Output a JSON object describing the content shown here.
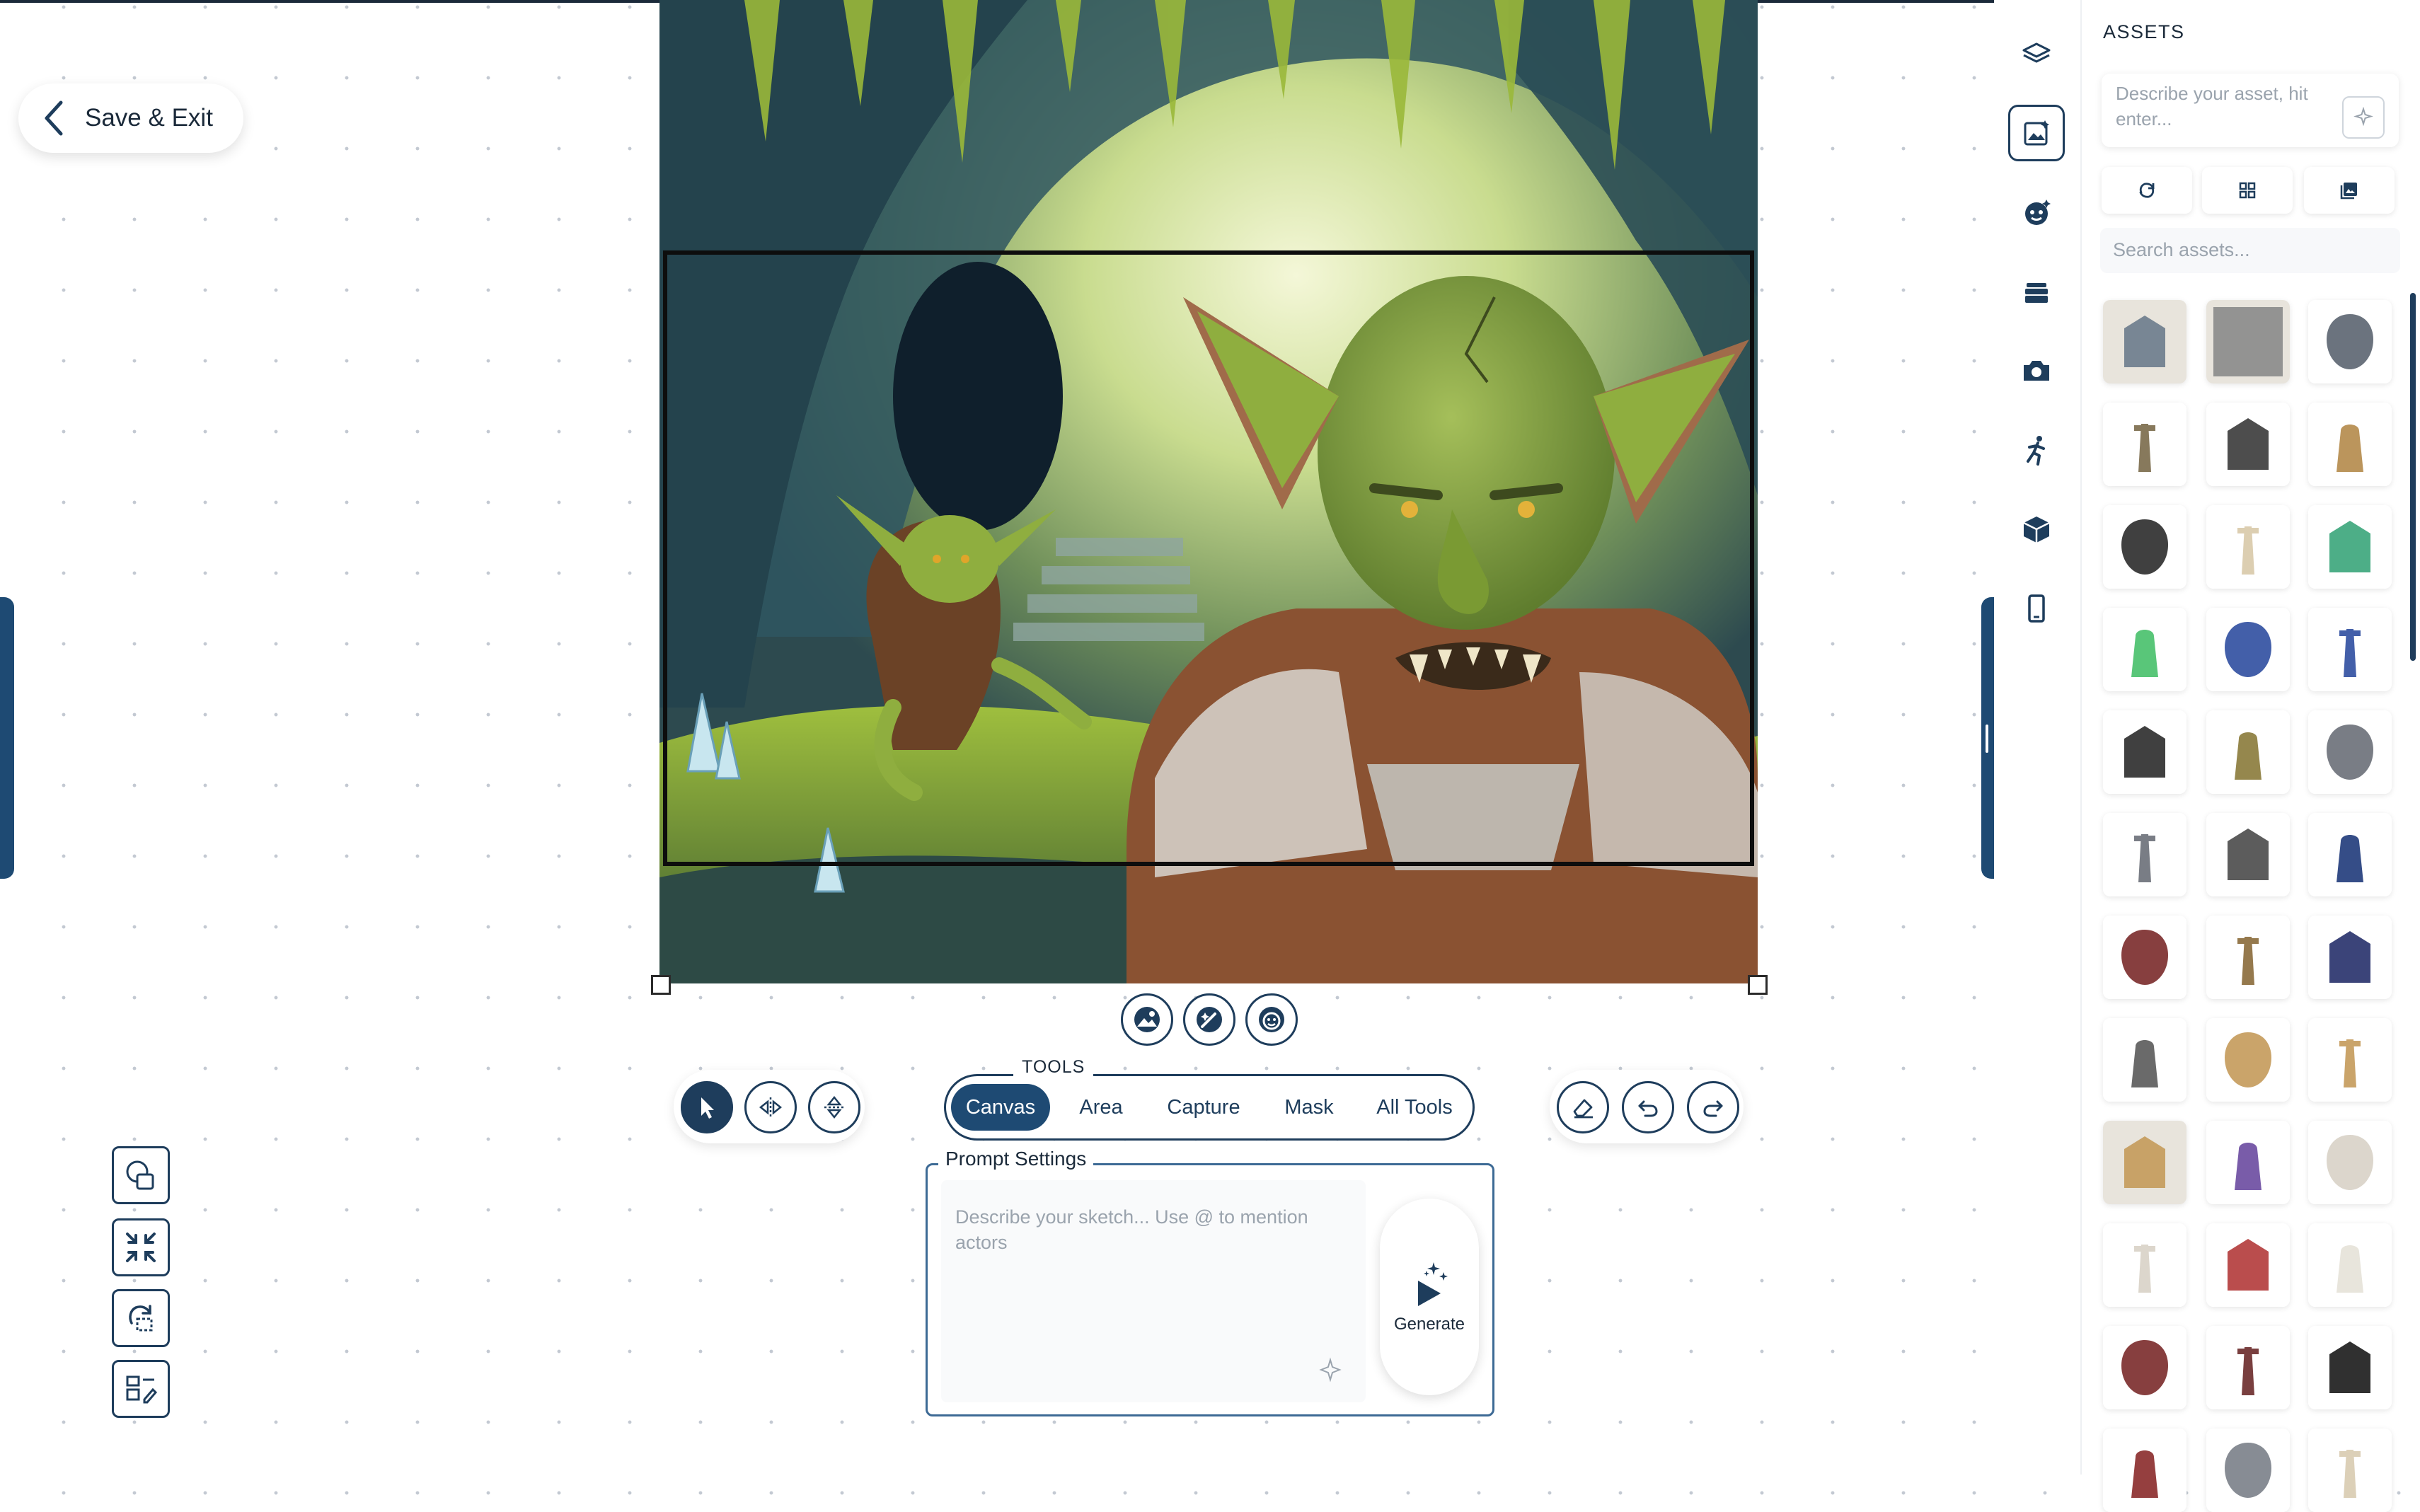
{
  "header": {
    "save_exit_label": "Save & Exit"
  },
  "toolbar": {
    "tools_label": "TOOLS",
    "tabs": [
      {
        "label": "Canvas",
        "active": true
      },
      {
        "label": "Area",
        "active": false
      },
      {
        "label": "Capture",
        "active": false
      },
      {
        "label": "Mask",
        "active": false
      },
      {
        "label": "All Tools",
        "active": false
      }
    ],
    "left_tools": [
      "cursor-icon",
      "flip-horizontal-icon",
      "flip-vertical-icon"
    ],
    "right_tools": [
      "eraser-icon",
      "undo-icon",
      "redo-icon"
    ]
  },
  "canvas_actions": [
    "image-background-icon",
    "magic-edit-icon",
    "character-icon"
  ],
  "prompt": {
    "label": "Prompt Settings",
    "placeholder": "Describe your sketch... Use @ to mention actors",
    "generate_label": "Generate"
  },
  "quick_tools": [
    "shapes-icon",
    "compress-icon",
    "refresh-area-icon",
    "layout-edit-icon"
  ],
  "rail": {
    "icons": [
      {
        "name": "layers-icon",
        "active": false
      },
      {
        "name": "assets-icon",
        "active": true
      },
      {
        "name": "character-icon",
        "active": false
      },
      {
        "name": "stack-icon",
        "active": false
      },
      {
        "name": "camera-icon",
        "active": false
      },
      {
        "name": "pose-icon",
        "active": false
      },
      {
        "name": "3d-box-icon",
        "active": false
      },
      {
        "name": "mobile-icon",
        "active": false
      }
    ]
  },
  "assets": {
    "title": "ASSETS",
    "describe_placeholder": "Describe your asset, hit enter...",
    "search_placeholder": "Search assets...",
    "options": [
      "refresh-icon",
      "grid-icon",
      "gallery-icon"
    ],
    "tiles": [
      "tools-asset",
      "gray-texture-asset",
      "iron-gate-asset",
      "robot-asset",
      "walker-robot-asset",
      "mech-asset",
      "gaming-chair-asset",
      "pirate-skull-asset",
      "lifedev-logo-asset",
      "green-orb-asset",
      "lifedev-badge-asset",
      "lifedev-badge-2-asset",
      "man-portrait-asset",
      "knight-asset",
      "shield-asset",
      "sword-asset",
      "cathedral-asset",
      "blue-guitar-asset",
      "red-guitar-asset",
      "pirate-ship-asset",
      "anime-girl-asset",
      "viking-asset",
      "camel-asset",
      "camel-2-asset",
      "camel-desert-asset",
      "purple-ram-asset",
      "white-goat-asset",
      "sheep-asset",
      "caped-sheep-asset",
      "fluffy-sheep-asset",
      "demon-asset",
      "demon-2-asset",
      "vampire-asset",
      "winged-demon-asset",
      "armored-figure-asset",
      "plate-asset"
    ]
  },
  "colors": {
    "accent": "#1e4a73",
    "dark": "#1e3d5c",
    "text": "#1b2a3a",
    "placeholder": "#9aa3ad"
  }
}
